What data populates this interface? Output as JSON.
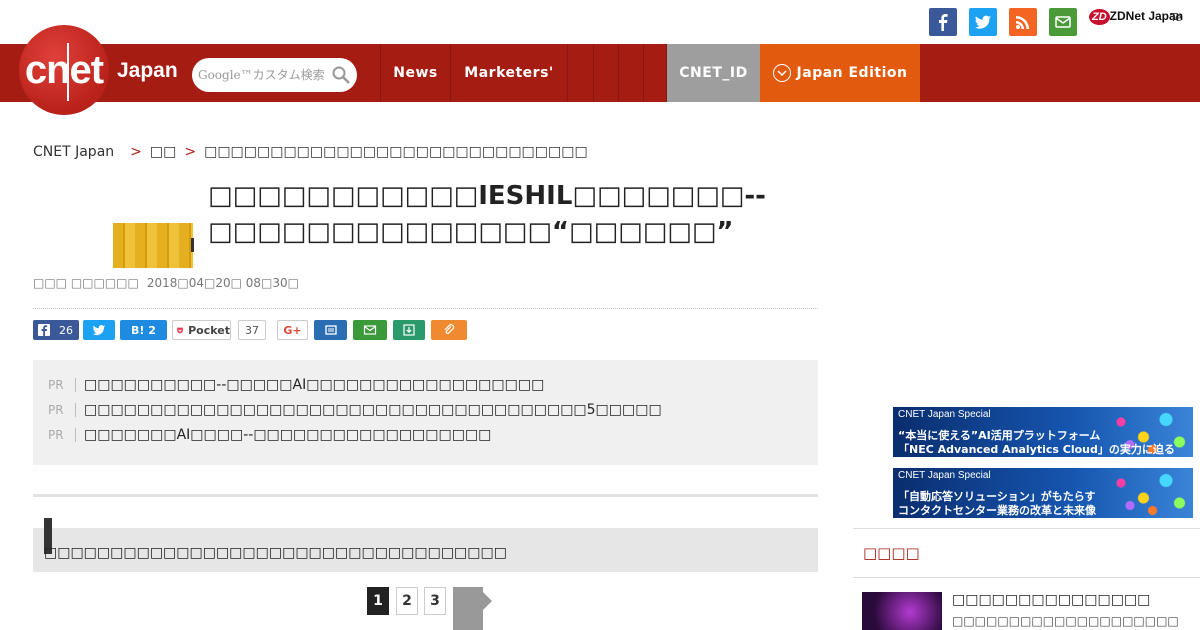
{
  "topbar": {
    "social": [
      {
        "name": "facebook",
        "color": "#3b5998"
      },
      {
        "name": "twitter",
        "color": "#1da1f2"
      },
      {
        "name": "rss",
        "color": "#f26522"
      },
      {
        "name": "mail",
        "color": "#4a9a3a"
      }
    ],
    "zdnet_label": "ZDNet Japan",
    "te_label": "Te"
  },
  "header": {
    "logo_text": "cnet",
    "brand_suffix": "Japan",
    "search_placeholder": "Google™カスタム検索",
    "nav": {
      "news": "News",
      "marketers": "Marketers'",
      "cnet_id": "CNET_ID",
      "edition": "Japan Edition"
    },
    "colors": {
      "bar": "#a51c12",
      "cnetid": "#9e9e9e",
      "edition": "#e25a0e"
    }
  },
  "breadcrumb": {
    "home": "CNET Japan",
    "section": "□□",
    "current": "□□□□□□□□□□□□□□□□□□□□□□□□□□□□□"
  },
  "article": {
    "title": "□□□□□□□□□□□IESHIL□□□□□□□--□□□□□□□□□□□□□□“□□□□□□”",
    "author": "□□□ □□□□□□",
    "date": "2018□04□20□ 08□30□"
  },
  "share": {
    "facebook_count": "26",
    "hatena_label": "B! 2",
    "pocket_label": "Pocket",
    "pocket_count": "37",
    "gplus_label": "G+"
  },
  "pr": {
    "tag": "PR",
    "items": [
      "□□□□□□□□□□--□□□□□AI□□□□□□□□□□□□□□□□□□",
      "□□□□□□□□□□□□□□□□□□□□□□□□□□□□□□□□□□□□□□5□□□□□",
      "□□□□□□□AI□□□□--□□□□□□□□□□□□□□□□□□"
    ]
  },
  "section_lead": "□□□□□□□□□□□□□□□□□□□□□□□□□□□□□□□□□□□",
  "pagination": [
    "1",
    "2",
    "3"
  ],
  "sidebar": {
    "banners": [
      {
        "special": "CNET Japan Special",
        "line1": "“本当に使える”AI活用プラットフォーム",
        "line2": "「NEC Advanced Analytics Cloud」の実力に迫る"
      },
      {
        "special": "CNET Japan Special",
        "line1": "「自動応答ソリューション」がもたらす",
        "line2": "コンタクトセンター業務の改革と未来像"
      }
    ],
    "heading": "□□□□",
    "item_title": "□□□□□□□□□□□□□□□",
    "item_sub": "□□□□□□□□□□□□□□□□□□□□"
  }
}
